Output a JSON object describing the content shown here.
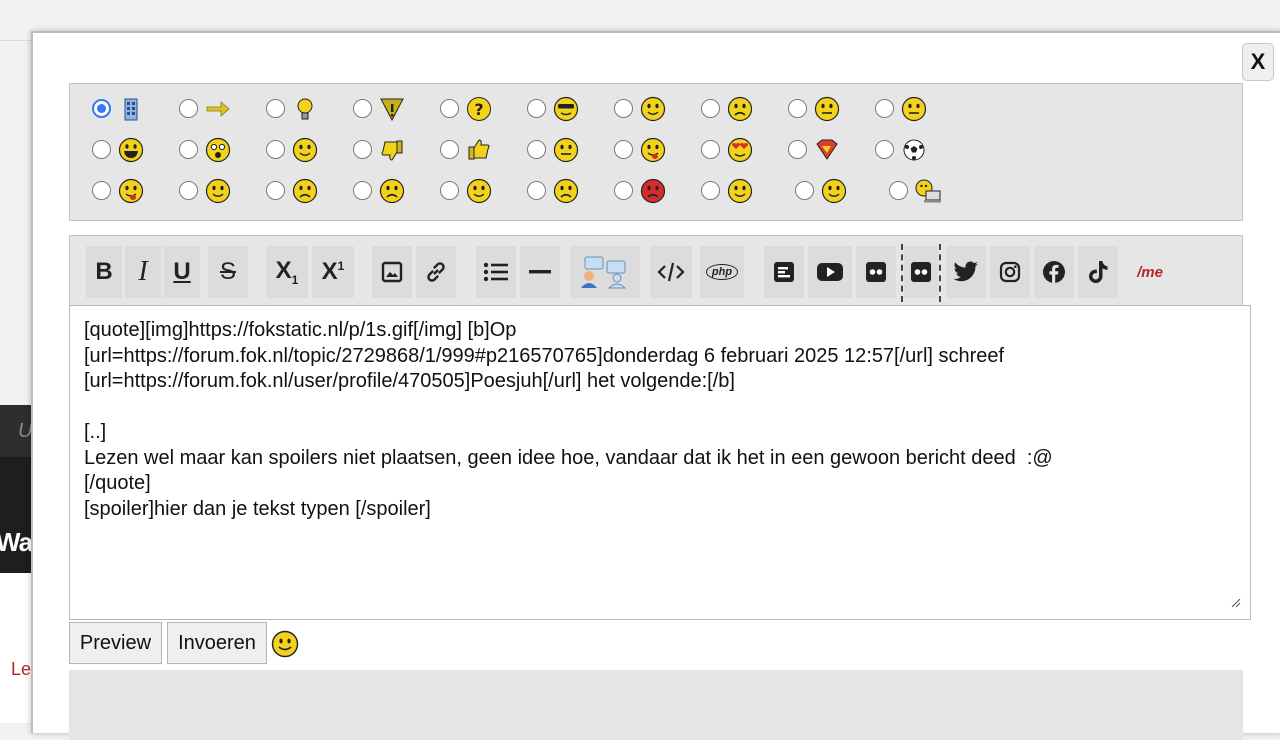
{
  "page": {
    "background_partial_text": {
      "u": "U",
      "waa": "Waa",
      "le": "Le",
      "right": ":"
    }
  },
  "modal": {
    "close_label": "X",
    "smilies": {
      "row1": [
        "building-icon",
        "arrow-right-icon",
        "lightbulb-icon",
        "warning-icon",
        "question-icon",
        "cool-icon",
        "smile-icon",
        "frown-icon",
        "mad-icon",
        "unimpressed-icon"
      ],
      "row2": [
        "grin-icon",
        "surprised-icon",
        "smile2-icon",
        "thumbs-down-icon",
        "thumbs-up-icon",
        "neutral-icon",
        "tongue-icon",
        "love-icon",
        "superman-icon",
        "football-icon"
      ],
      "row3": [
        "drooling-icon",
        "happy-icon",
        "sad-icon",
        "sad2-icon",
        "blush-icon",
        "angry-icon",
        "devil-icon",
        "clap-icon",
        "wave-icon",
        "computer-icon"
      ],
      "selected": "building-icon"
    },
    "toolbar": {
      "bold": "B",
      "italic": "I",
      "underline": "U",
      "strike": "S",
      "subscript": "X",
      "subscript_sub": "1",
      "superscript": "X",
      "superscript_sup": "1",
      "php_label": "php",
      "me_label": "/me"
    },
    "editor": {
      "value": "[quote][img]https://fokstatic.nl/p/1s.gif[/img] [b]Op\n[url=https://forum.fok.nl/topic/2729868/1/999#p216570765]donderdag 6 februari 2025 12:57[/url] schreef\n[url=https://forum.fok.nl/user/profile/470505]Poesjuh[/url] het volgende:[/b]\n\n[..]\nLezen wel maar kan spoilers niet plaatsen, geen idee hoe, vandaar dat ik het in een gewoon bericht deed  :@\n[/quote]\n[spoiler]hier dan je tekst typen [/spoiler]"
    },
    "buttons": {
      "preview": "Preview",
      "submit": "Invoeren"
    },
    "colors": {
      "radio_accent": "#3478f6",
      "smiley_yellow": "#f3d21b",
      "me_red": "#b3282d"
    }
  }
}
